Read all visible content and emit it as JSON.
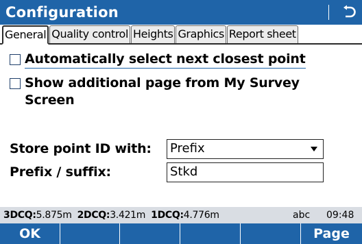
{
  "window": {
    "title": "Configuration"
  },
  "tabs": [
    {
      "label": "General",
      "active": true
    },
    {
      "label": "Quality control",
      "active": false
    },
    {
      "label": "Heights",
      "active": false
    },
    {
      "label": "Graphics",
      "active": false
    },
    {
      "label": "Report sheet",
      "active": false
    }
  ],
  "options": {
    "auto_select": {
      "label": "Automatically select next closest point",
      "checked": false
    },
    "additional_page": {
      "line1": "Show additional page from My Survey",
      "line2": "Screen",
      "checked": false
    }
  },
  "store_point_id": {
    "label": "Store point ID with:",
    "value": "Prefix"
  },
  "prefix_suffix": {
    "label": "Prefix / suffix:",
    "value": "Stkd"
  },
  "status": {
    "dcq3_label": "3DCQ:",
    "dcq3_value": "5.875m",
    "dcq2_label": "2DCQ:",
    "dcq2_value": "3.421m",
    "dcq1_label": "1DCQ:",
    "dcq1_value": "4.776m",
    "input_mode": "abc",
    "time": "09:48"
  },
  "softkeys": {
    "ok": "OK",
    "page": "Page"
  },
  "colors": {
    "accent": "#1f64a8",
    "status_bg": "#d9dde3"
  }
}
